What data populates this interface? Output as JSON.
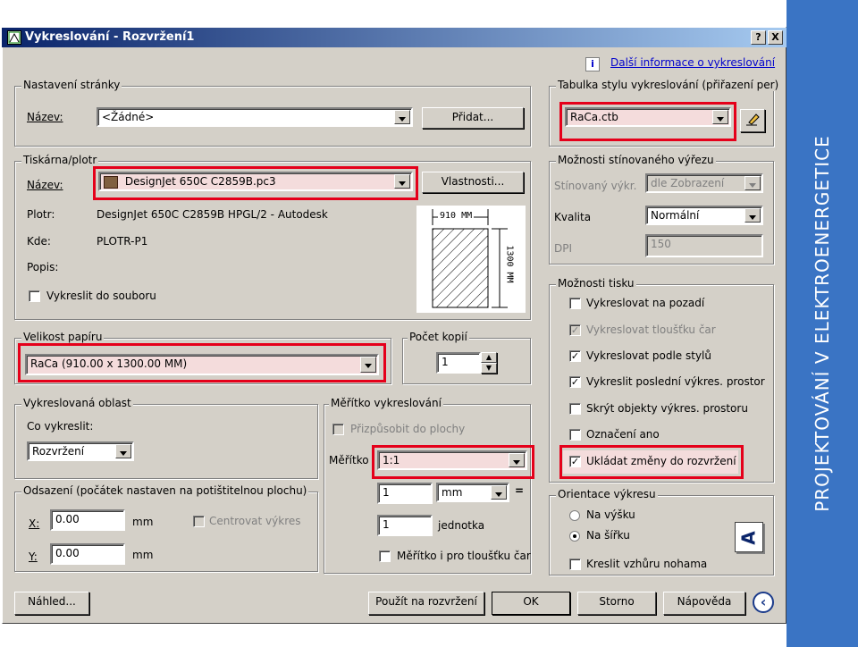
{
  "window": {
    "title": "Vykreslování - Rozvržení1",
    "help_btn": "?",
    "close_btn": "X"
  },
  "side_banner": "PROJEKTOVÁNÍ V ELEKTROENERGETICE",
  "more_info": {
    "icon": "i",
    "link": "Další informace o vykreslování"
  },
  "page_setup": {
    "title": "Nastavení stránky",
    "name_label": "Název:",
    "name_value": "<Žádné>",
    "add_button": "Přidat..."
  },
  "plot_style_table": {
    "title": "Tabulka stylu vykreslování (přiřazení per)",
    "value": "RaCa.ctb"
  },
  "printer": {
    "title": "Tiskárna/plotr",
    "name_label": "Název:",
    "name_value": "DesignJet 650C C2859B.pc3",
    "properties_button": "Vlastnosti...",
    "plotter_label": "Plotr:",
    "plotter_value": "DesignJet 650C C2859B HPGL/2 - Autodesk",
    "where_label": "Kde:",
    "where_value": "PLOTR-P1",
    "desc_label": "Popis:",
    "to_file_label": "Vykreslit do souboru",
    "preview_width": "910 MM",
    "preview_height": "1300 MM"
  },
  "shaded_viewport": {
    "title": "Možnosti stínovaného výřezu",
    "shade_label": "Stínovaný výkr.",
    "shade_value": "dle Zobrazení",
    "quality_label": "Kvalita",
    "quality_value": "Normální",
    "dpi_label": "DPI",
    "dpi_value": "150"
  },
  "plot_options": {
    "title": "Možnosti tisku",
    "items": [
      {
        "label": "Vykreslovat na pozadí",
        "checked": false,
        "disabled": false
      },
      {
        "label": "Vykreslovat tloušťku čar",
        "checked": true,
        "disabled": true
      },
      {
        "label": "Vykreslovat podle stylů",
        "checked": true,
        "disabled": false
      },
      {
        "label": "Vykreslit poslední výkres. prostor",
        "checked": true,
        "disabled": false
      },
      {
        "label": "Skrýt objekty výkres. prostoru",
        "checked": false,
        "disabled": false
      },
      {
        "label": "Označení ano",
        "checked": false,
        "disabled": false
      },
      {
        "label": "Ukládat změny do rozvržení",
        "checked": true,
        "disabled": false
      }
    ]
  },
  "paper_size": {
    "title": "Velikost papíru",
    "value": "RaCa (910.00 x 1300.00 MM)"
  },
  "copies": {
    "title": "Počet kopií",
    "value": "1"
  },
  "plot_area": {
    "title": "Vykreslovaná oblast",
    "what_label": "Co vykreslit:",
    "what_value": "Rozvržení"
  },
  "plot_scale": {
    "title": "Měřítko vykreslování",
    "fit_label": "Přizpůsobit do plochy",
    "scale_label": "Měřítko",
    "scale_value": "1:1",
    "value1": "1",
    "unit": "mm",
    "equals": "=",
    "value2": "1",
    "unit2": "jednotka",
    "lineweights_label": "Měřítko i pro tloušťku čar"
  },
  "plot_offset": {
    "title": "Odsazení (počátek nastaven na potištitelnou plochu)",
    "x_label": "X:",
    "x_value": "0.00",
    "x_unit": "mm",
    "y_label": "Y:",
    "y_value": "0.00",
    "y_unit": "mm",
    "center_label": "Centrovat výkres"
  },
  "orientation": {
    "title": "Orientace výkresu",
    "portrait": "Na výšku",
    "landscape": "Na šířku",
    "upside_down": "Kreslit vzhůru nohama",
    "icon_letter": "A"
  },
  "buttons": {
    "preview": "Náhled...",
    "apply": "Použít na rozvržení",
    "ok": "OK",
    "cancel": "Storno",
    "help": "Nápověda",
    "collapse": "‹"
  },
  "colors": {
    "highlight": "#e5001a",
    "sideband": "#3a74c4",
    "dialog": "#d4d0c8"
  }
}
